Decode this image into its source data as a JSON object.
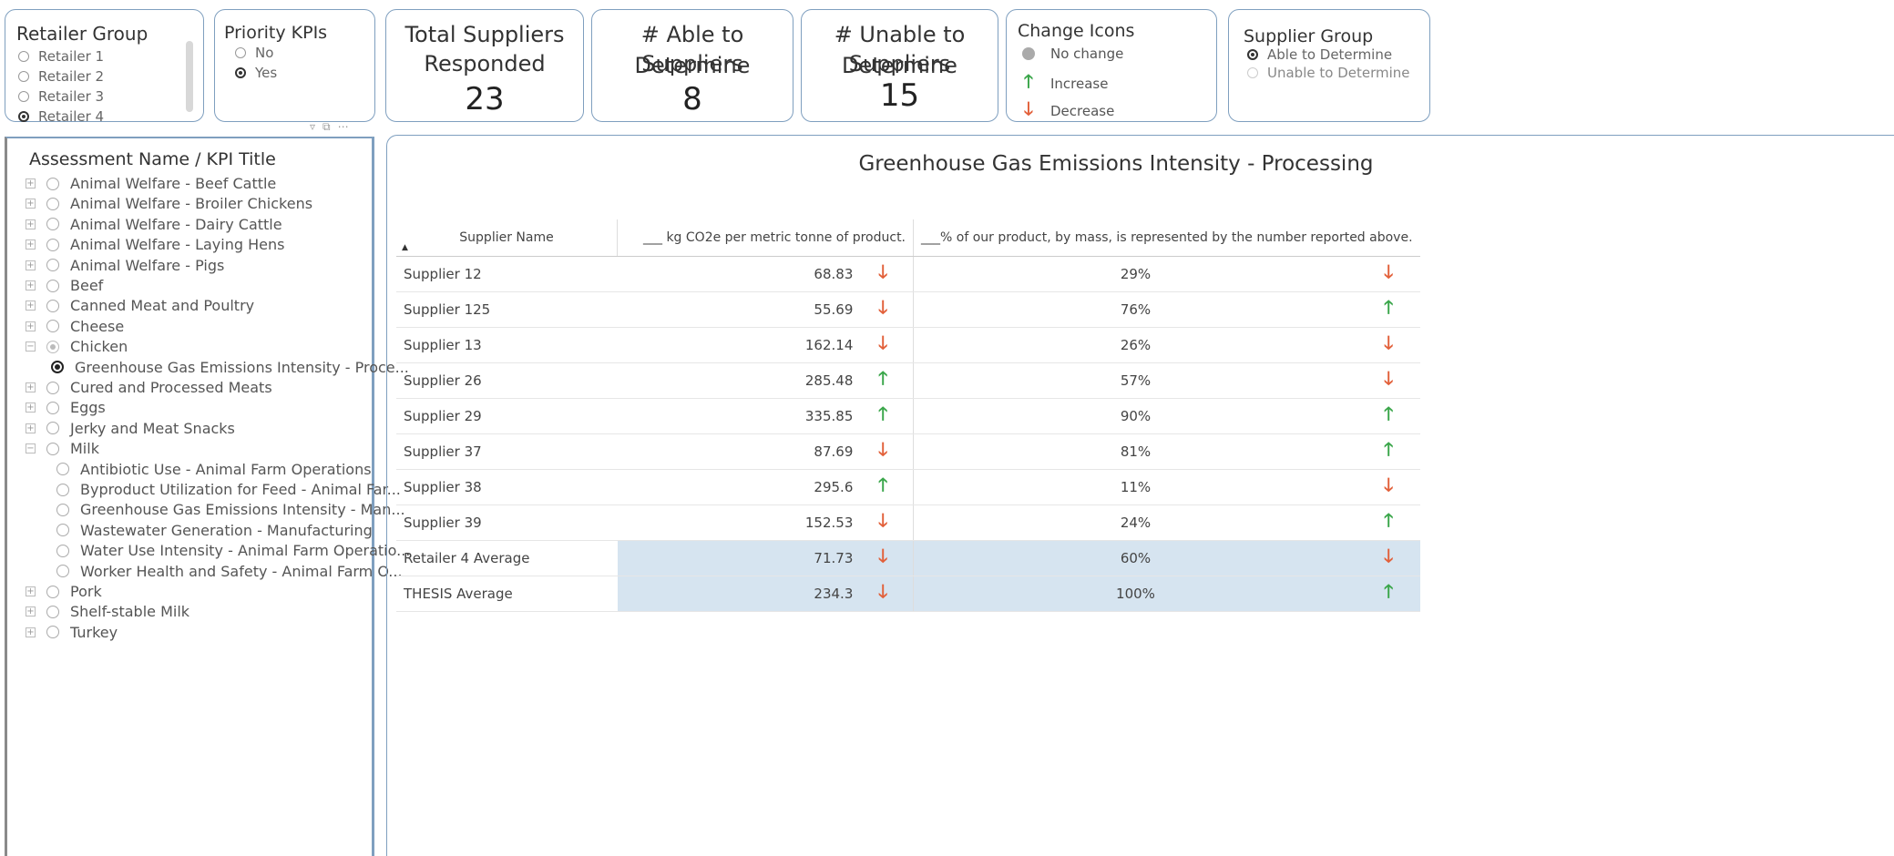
{
  "retailer_group": {
    "title": "Retailer Group",
    "options": [
      {
        "label": "Retailer 1",
        "selected": false
      },
      {
        "label": "Retailer 2",
        "selected": false
      },
      {
        "label": "Retailer 3",
        "selected": false
      },
      {
        "label": "Retailer 4",
        "selected": true
      }
    ]
  },
  "priority_kpis": {
    "title": "Priority KPIs",
    "options": [
      {
        "label": "No",
        "selected": false
      },
      {
        "label": "Yes",
        "selected": true
      }
    ]
  },
  "kpi_cards": [
    {
      "title_line1": "Total Suppliers",
      "title_line2": "Responded",
      "value": "23"
    },
    {
      "title_line1": "# Able to Determine",
      "title_line2": "Suppliers",
      "value": "8"
    },
    {
      "title_line1": "# Unable to Determine",
      "title_line2": "Suppliers",
      "value": "15"
    }
  ],
  "change_icons": {
    "title": "Change Icons",
    "items": [
      {
        "icon": "gray-circle-icon",
        "label": "No change"
      },
      {
        "icon": "green-up-arrow-icon",
        "label": "Increase"
      },
      {
        "icon": "red-down-arrow-icon",
        "label": "Decrease"
      }
    ]
  },
  "supplier_group": {
    "title": "Supplier Group",
    "options": [
      {
        "label": "Able to Determine",
        "selected": true
      },
      {
        "label": "Unable to Determine",
        "selected": false
      }
    ]
  },
  "tree": {
    "header": "Assessment Name / KPI Title",
    "items": [
      {
        "label": "Animal Welfare - Beef Cattle",
        "level": 0,
        "expander": "+",
        "state": "none"
      },
      {
        "label": "Animal Welfare - Broiler Chickens",
        "level": 0,
        "expander": "+",
        "state": "none"
      },
      {
        "label": "Animal Welfare - Dairy Cattle",
        "level": 0,
        "expander": "+",
        "state": "none"
      },
      {
        "label": "Animal Welfare - Laying Hens",
        "level": 0,
        "expander": "+",
        "state": "none"
      },
      {
        "label": "Animal Welfare - Pigs",
        "level": 0,
        "expander": "+",
        "state": "none"
      },
      {
        "label": "Beef",
        "level": 0,
        "expander": "+",
        "state": "none"
      },
      {
        "label": "Canned Meat and Poultry",
        "level": 0,
        "expander": "+",
        "state": "none"
      },
      {
        "label": "Cheese",
        "level": 0,
        "expander": "+",
        "state": "none"
      },
      {
        "label": "Chicken",
        "level": 0,
        "expander": "−",
        "state": "partial"
      },
      {
        "label": "Greenhouse Gas Emissions Intensity - Proce...",
        "level": 1,
        "expander": "",
        "state": "selected"
      },
      {
        "label": "Cured and Processed Meats",
        "level": 0,
        "expander": "+",
        "state": "none"
      },
      {
        "label": "Eggs",
        "level": 0,
        "expander": "+",
        "state": "none"
      },
      {
        "label": "Jerky and Meat Snacks",
        "level": 0,
        "expander": "+",
        "state": "none"
      },
      {
        "label": "Milk",
        "level": 0,
        "expander": "−",
        "state": "none"
      },
      {
        "label": "Antibiotic Use - Animal Farm Operations",
        "level": 1,
        "expander": "",
        "state": "none"
      },
      {
        "label": "Byproduct Utilization for Feed - Animal Far...",
        "level": 1,
        "expander": "",
        "state": "none"
      },
      {
        "label": "Greenhouse Gas Emissions Intensity - Man...",
        "level": 1,
        "expander": "",
        "state": "none"
      },
      {
        "label": "Wastewater Generation - Manufacturing",
        "level": 1,
        "expander": "",
        "state": "none"
      },
      {
        "label": "Water Use Intensity - Animal Farm Operatio...",
        "level": 1,
        "expander": "",
        "state": "none"
      },
      {
        "label": "Worker Health and Safety - Animal Farm O...",
        "level": 1,
        "expander": "",
        "state": "none"
      },
      {
        "label": "Pork",
        "level": 0,
        "expander": "+",
        "state": "none"
      },
      {
        "label": "Shelf-stable Milk",
        "level": 0,
        "expander": "+",
        "state": "none"
      },
      {
        "label": "Turkey",
        "level": 0,
        "expander": "+",
        "state": "none"
      }
    ]
  },
  "table": {
    "title": "Greenhouse Gas Emissions Intensity - Processing",
    "columns": [
      "Supplier Name",
      "___ kg CO2e per metric tonne of product.",
      "___% of our product, by mass, is represented by the number reported above."
    ],
    "rows": [
      {
        "name": "Supplier 12",
        "value": "68.83",
        "value_change": "down",
        "pct": "29%",
        "pct_change": "down",
        "avg": false
      },
      {
        "name": "Supplier 125",
        "value": "55.69",
        "value_change": "down",
        "pct": "76%",
        "pct_change": "up",
        "avg": false
      },
      {
        "name": "Supplier 13",
        "value": "162.14",
        "value_change": "down",
        "pct": "26%",
        "pct_change": "down",
        "avg": false
      },
      {
        "name": "Supplier 26",
        "value": "285.48",
        "value_change": "up",
        "pct": "57%",
        "pct_change": "down",
        "avg": false
      },
      {
        "name": "Supplier 29",
        "value": "335.85",
        "value_change": "up",
        "pct": "90%",
        "pct_change": "up",
        "avg": false
      },
      {
        "name": "Supplier 37",
        "value": "87.69",
        "value_change": "down",
        "pct": "81%",
        "pct_change": "up",
        "avg": false
      },
      {
        "name": "Supplier 38",
        "value": "295.6",
        "value_change": "up",
        "pct": "11%",
        "pct_change": "down",
        "avg": false
      },
      {
        "name": "Supplier 39",
        "value": "152.53",
        "value_change": "down",
        "pct": "24%",
        "pct_change": "up",
        "avg": false
      },
      {
        "name": "Retailer 4 Average",
        "value": "71.73",
        "value_change": "down",
        "pct": "60%",
        "pct_change": "down",
        "avg": true
      },
      {
        "name": "THESIS Average",
        "value": "234.3",
        "value_change": "down",
        "pct": "100%",
        "pct_change": "up",
        "avg": true
      }
    ]
  },
  "colors": {
    "increase": "#3aa64a",
    "decrease": "#e2603a",
    "no_change": "#aaaaaa",
    "card_border": "#7f9fbf",
    "average_highlight": "#d6e4f0"
  }
}
